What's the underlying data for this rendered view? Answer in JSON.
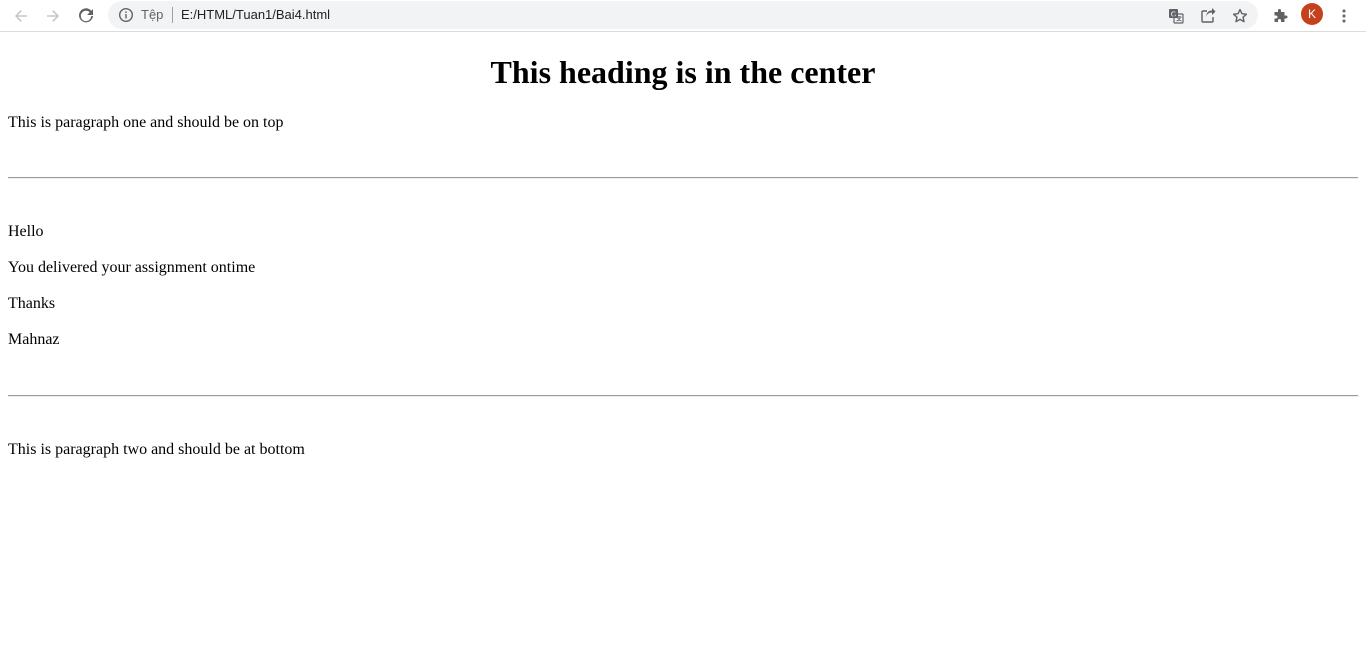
{
  "browser": {
    "site_info_label": "Tệp",
    "url": "E:/HTML/Tuan1/Bai4.html",
    "profile_initial": "K",
    "profile_color": "#c5401c",
    "icons": {
      "back": "arrow-left-icon",
      "forward": "arrow-right-icon",
      "reload": "reload-icon",
      "info": "info-icon",
      "translate": "translate-icon",
      "share": "share-icon",
      "bookmark": "star-icon",
      "extensions": "puzzle-icon",
      "menu": "kebab-menu-icon"
    }
  },
  "page": {
    "heading": "This heading is in the center",
    "paragraph_one": "This is paragraph one and should be on top",
    "letter": {
      "greeting": "Hello",
      "body": "You delivered your assignment ontime",
      "closing": "Thanks",
      "signature": "Mahnaz"
    },
    "paragraph_two": "This is paragraph two and should be at bottom"
  }
}
